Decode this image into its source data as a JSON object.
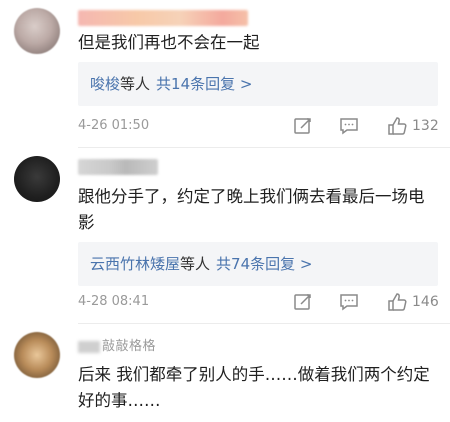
{
  "comments": [
    {
      "username": "▆▆▆▆▆▆▆▆▆▆▆▆",
      "text": "但是我们再也不会在一起",
      "reply_preview": {
        "name": "唆梭",
        "suffix": "等人",
        "count": "共14条回复 >"
      },
      "time": "4-26 01:50",
      "likes": "132"
    },
    {
      "username": "▆▆▆▆▆▆",
      "text": "跟他分手了，约定了晚上我们俩去看最后一场电影",
      "reply_preview": {
        "name": "云西竹林矮屋",
        "suffix": "等人",
        "count": "共74条回复 >"
      },
      "time": "4-28 08:41",
      "likes": "146"
    },
    {
      "username": "敲敲格格",
      "text": "后来 我们都牵了别人的手……做着我们两个约定好的事……"
    }
  ],
  "icons": {
    "edit": "edit-icon",
    "comment": "comment-icon",
    "like": "thumbs-up-icon"
  },
  "colors": {
    "link": "#4a74ad",
    "meta": "#9a9a9a",
    "reply_bg": "#f4f5f7"
  }
}
